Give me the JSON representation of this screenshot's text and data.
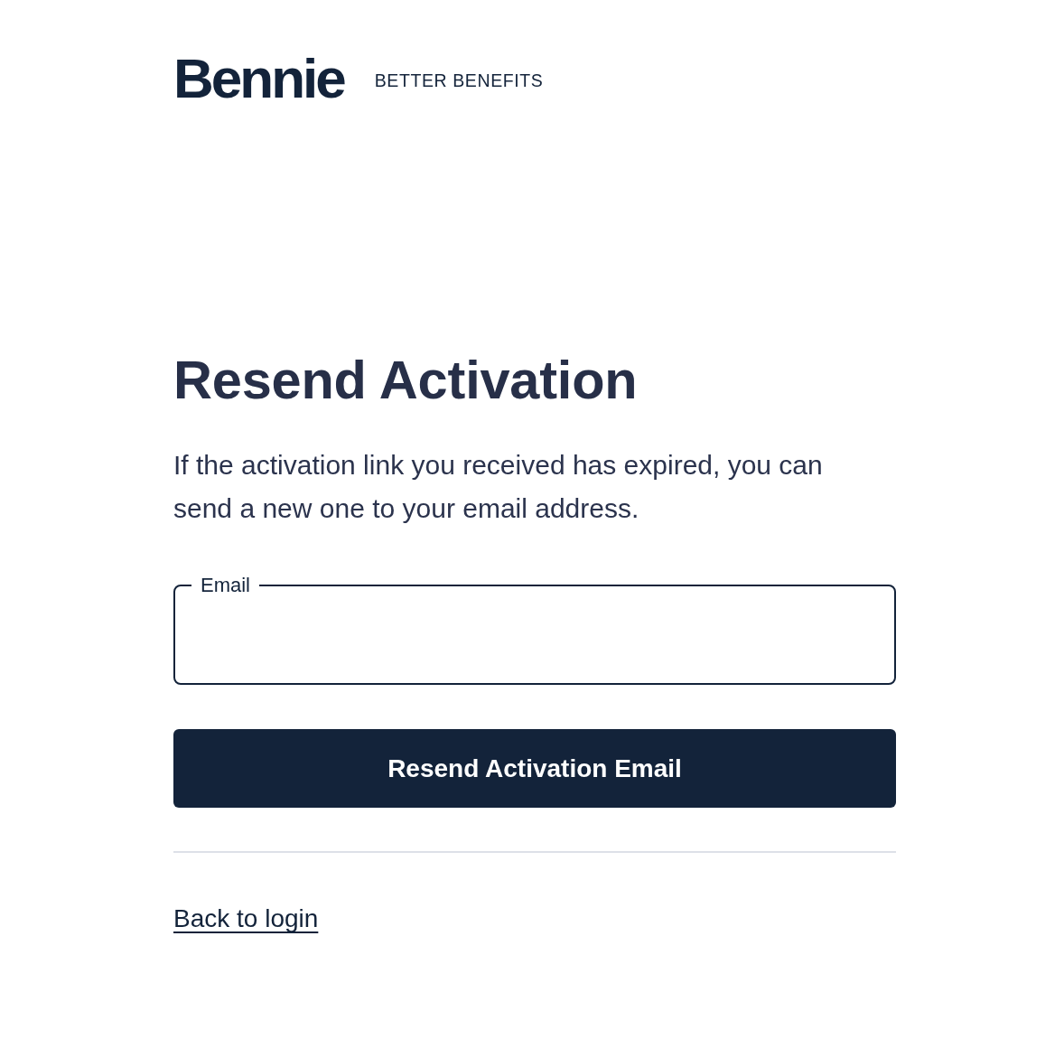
{
  "header": {
    "logo": "Bennie",
    "tagline": "BETTER BENEFITS"
  },
  "title": "Resend Activation",
  "description": "If the activation link you received has expired, you can send a new one to your email address.",
  "form": {
    "email_field": {
      "label": "Email"
    },
    "submit_button": "Resend Activation Email"
  },
  "footer_link": "Back to login"
}
